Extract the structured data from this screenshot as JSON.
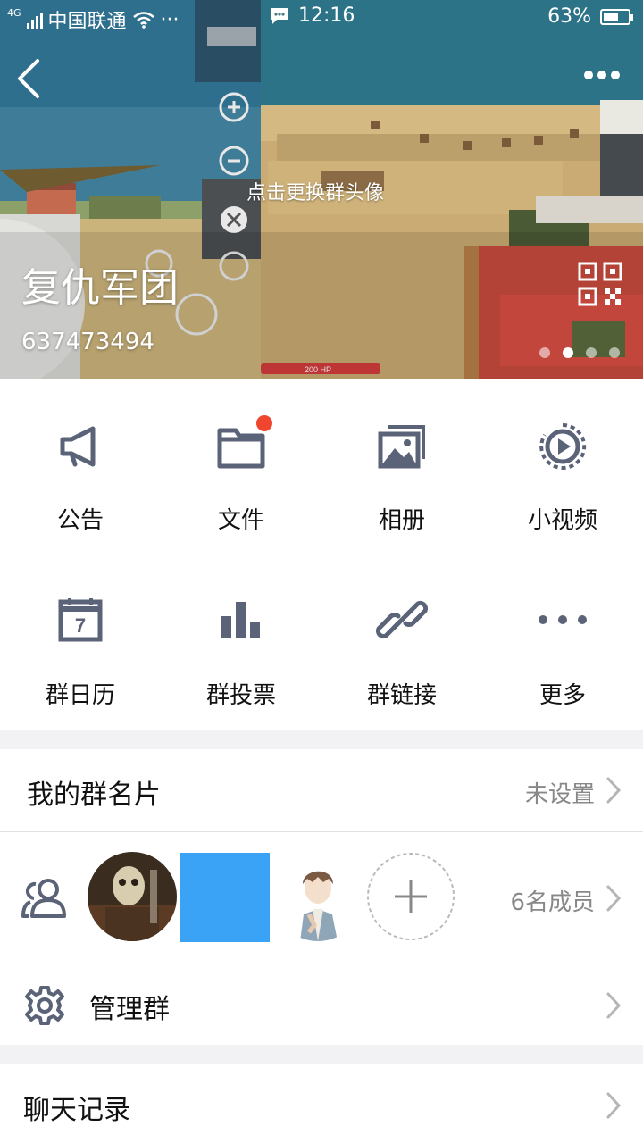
{
  "status_bar": {
    "network_type": "4G",
    "carrier": "中国联通",
    "overflow": "···",
    "time": "12:16",
    "battery": "63%",
    "battery_level": 0.63
  },
  "header": {
    "change_avatar_hint": "点击更换群头像",
    "group_name": "复仇军团",
    "group_id": "637473494",
    "carousel": {
      "count": 4,
      "active_index": 1
    },
    "hud_label": "200 HP"
  },
  "features": [
    {
      "label": "公告",
      "icon": "megaphone-icon"
    },
    {
      "label": "文件",
      "icon": "folder-icon",
      "badge": true
    },
    {
      "label": "相册",
      "icon": "photo-album-icon"
    },
    {
      "label": "小视频",
      "icon": "video-play-icon"
    },
    {
      "label": "群日历",
      "icon": "calendar-icon",
      "glyph": "7"
    },
    {
      "label": "群投票",
      "icon": "bar-chart-icon"
    },
    {
      "label": "群链接",
      "icon": "link-icon"
    },
    {
      "label": "更多",
      "icon": "more-dots-icon"
    }
  ],
  "my_card": {
    "label": "我的群名片",
    "value": "未设置"
  },
  "members": {
    "count_label": "6名成员"
  },
  "manage": {
    "label": "管理群"
  },
  "chat_history": {
    "label": "聊天记录"
  },
  "colors": {
    "icon_gray": "#5b6378",
    "badge_red": "#f0452f",
    "member_blue": "#3aa3f5",
    "background": "#f2f2f5"
  }
}
